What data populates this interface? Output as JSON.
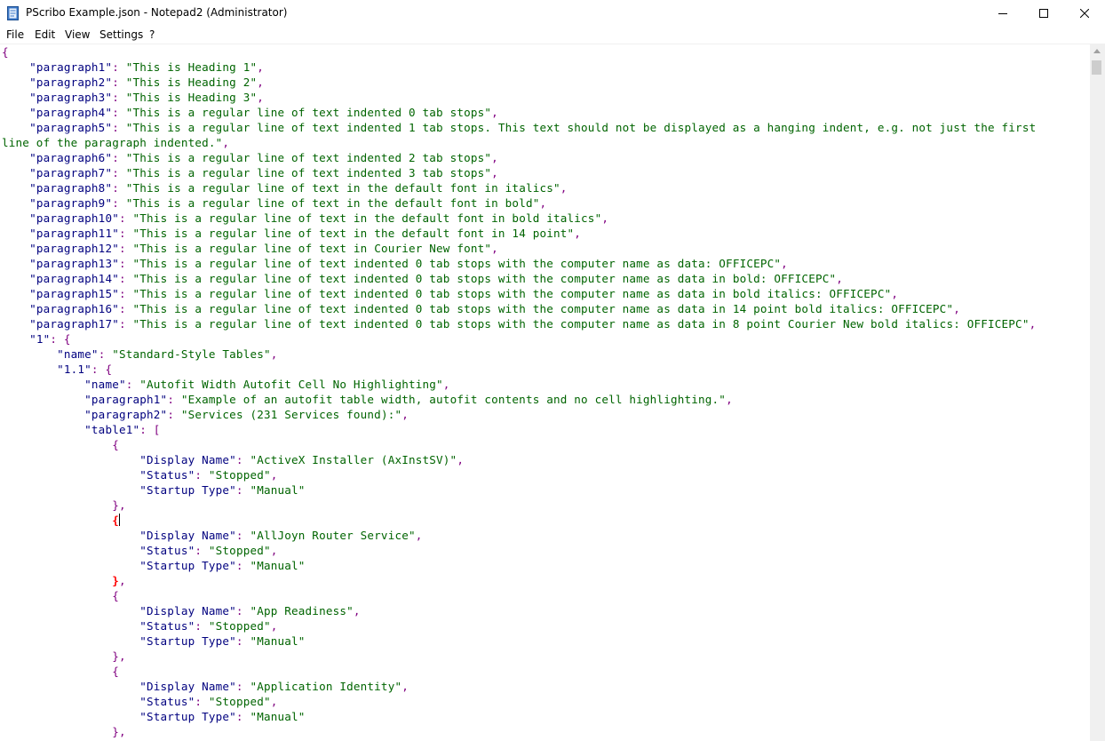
{
  "window": {
    "title": "PScribo Example.json - Notepad2 (Administrator)",
    "minimize_icon": "minimize-icon",
    "maximize_icon": "maximize-icon",
    "close_icon": "close-icon"
  },
  "menu": {
    "items": [
      {
        "label": "File"
      },
      {
        "label": "Edit"
      },
      {
        "label": "View"
      },
      {
        "label": "Settings"
      },
      {
        "label": "?"
      }
    ]
  },
  "colors": {
    "key": "#00007f",
    "string": "#006400",
    "punct": "#800080",
    "brace_highlight": "#ff0000"
  },
  "editor": {
    "lines": [
      [
        [
          "p",
          "{"
        ]
      ],
      [
        [
          "p",
          "    "
        ],
        [
          "k",
          "\"paragraph1\""
        ],
        [
          "p",
          ": "
        ],
        [
          "s",
          "\"This is Heading 1\""
        ],
        [
          "p",
          ","
        ]
      ],
      [
        [
          "p",
          "    "
        ],
        [
          "k",
          "\"paragraph2\""
        ],
        [
          "p",
          ": "
        ],
        [
          "s",
          "\"This is Heading 2\""
        ],
        [
          "p",
          ","
        ]
      ],
      [
        [
          "p",
          "    "
        ],
        [
          "k",
          "\"paragraph3\""
        ],
        [
          "p",
          ": "
        ],
        [
          "s",
          "\"This is Heading 3\""
        ],
        [
          "p",
          ","
        ]
      ],
      [
        [
          "p",
          "    "
        ],
        [
          "k",
          "\"paragraph4\""
        ],
        [
          "p",
          ": "
        ],
        [
          "s",
          "\"This is a regular line of text indented 0 tab stops\""
        ],
        [
          "p",
          ","
        ]
      ],
      [
        [
          "p",
          "    "
        ],
        [
          "k",
          "\"paragraph5\""
        ],
        [
          "p",
          ": "
        ],
        [
          "s",
          "\"This is a regular line of text indented 1 tab stops. This text should not be displayed as a hanging indent, e.g. not just the first"
        ]
      ],
      [
        [
          "s",
          "line of the paragraph indented.\""
        ],
        [
          "p",
          ","
        ]
      ],
      [
        [
          "p",
          "    "
        ],
        [
          "k",
          "\"paragraph6\""
        ],
        [
          "p",
          ": "
        ],
        [
          "s",
          "\"This is a regular line of text indented 2 tab stops\""
        ],
        [
          "p",
          ","
        ]
      ],
      [
        [
          "p",
          "    "
        ],
        [
          "k",
          "\"paragraph7\""
        ],
        [
          "p",
          ": "
        ],
        [
          "s",
          "\"This is a regular line of text indented 3 tab stops\""
        ],
        [
          "p",
          ","
        ]
      ],
      [
        [
          "p",
          "    "
        ],
        [
          "k",
          "\"paragraph8\""
        ],
        [
          "p",
          ": "
        ],
        [
          "s",
          "\"This is a regular line of text in the default font in italics\""
        ],
        [
          "p",
          ","
        ]
      ],
      [
        [
          "p",
          "    "
        ],
        [
          "k",
          "\"paragraph9\""
        ],
        [
          "p",
          ": "
        ],
        [
          "s",
          "\"This is a regular line of text in the default font in bold\""
        ],
        [
          "p",
          ","
        ]
      ],
      [
        [
          "p",
          "    "
        ],
        [
          "k",
          "\"paragraph10\""
        ],
        [
          "p",
          ": "
        ],
        [
          "s",
          "\"This is a regular line of text in the default font in bold italics\""
        ],
        [
          "p",
          ","
        ]
      ],
      [
        [
          "p",
          "    "
        ],
        [
          "k",
          "\"paragraph11\""
        ],
        [
          "p",
          ": "
        ],
        [
          "s",
          "\"This is a regular line of text in the default font in 14 point\""
        ],
        [
          "p",
          ","
        ]
      ],
      [
        [
          "p",
          "    "
        ],
        [
          "k",
          "\"paragraph12\""
        ],
        [
          "p",
          ": "
        ],
        [
          "s",
          "\"This is a regular line of text in Courier New font\""
        ],
        [
          "p",
          ","
        ]
      ],
      [
        [
          "p",
          "    "
        ],
        [
          "k",
          "\"paragraph13\""
        ],
        [
          "p",
          ": "
        ],
        [
          "s",
          "\"This is a regular line of text indented 0 tab stops with the computer name as data: OFFICEPC\""
        ],
        [
          "p",
          ","
        ]
      ],
      [
        [
          "p",
          "    "
        ],
        [
          "k",
          "\"paragraph14\""
        ],
        [
          "p",
          ": "
        ],
        [
          "s",
          "\"This is a regular line of text indented 0 tab stops with the computer name as data in bold: OFFICEPC\""
        ],
        [
          "p",
          ","
        ]
      ],
      [
        [
          "p",
          "    "
        ],
        [
          "k",
          "\"paragraph15\""
        ],
        [
          "p",
          ": "
        ],
        [
          "s",
          "\"This is a regular line of text indented 0 tab stops with the computer name as data in bold italics: OFFICEPC\""
        ],
        [
          "p",
          ","
        ]
      ],
      [
        [
          "p",
          "    "
        ],
        [
          "k",
          "\"paragraph16\""
        ],
        [
          "p",
          ": "
        ],
        [
          "s",
          "\"This is a regular line of text indented 0 tab stops with the computer name as data in 14 point bold italics: OFFICEPC\""
        ],
        [
          "p",
          ","
        ]
      ],
      [
        [
          "p",
          "    "
        ],
        [
          "k",
          "\"paragraph17\""
        ],
        [
          "p",
          ": "
        ],
        [
          "s",
          "\"This is a regular line of text indented 0 tab stops with the computer name as data in 8 point Courier New bold italics: OFFICEPC\""
        ],
        [
          "p",
          ","
        ]
      ],
      [
        [
          "p",
          "    "
        ],
        [
          "k",
          "\"1\""
        ],
        [
          "p",
          ": {"
        ]
      ],
      [
        [
          "p",
          "        "
        ],
        [
          "k",
          "\"name\""
        ],
        [
          "p",
          ": "
        ],
        [
          "s",
          "\"Standard-Style Tables\""
        ],
        [
          "p",
          ","
        ]
      ],
      [
        [
          "p",
          "        "
        ],
        [
          "k",
          "\"1.1\""
        ],
        [
          "p",
          ": {"
        ]
      ],
      [
        [
          "p",
          "            "
        ],
        [
          "k",
          "\"name\""
        ],
        [
          "p",
          ": "
        ],
        [
          "s",
          "\"Autofit Width Autofit Cell No Highlighting\""
        ],
        [
          "p",
          ","
        ]
      ],
      [
        [
          "p",
          "            "
        ],
        [
          "k",
          "\"paragraph1\""
        ],
        [
          "p",
          ": "
        ],
        [
          "s",
          "\"Example of an autofit table width, autofit contents and no cell highlighting.\""
        ],
        [
          "p",
          ","
        ]
      ],
      [
        [
          "p",
          "            "
        ],
        [
          "k",
          "\"paragraph2\""
        ],
        [
          "p",
          ": "
        ],
        [
          "s",
          "\"Services (231 Services found):\""
        ],
        [
          "p",
          ","
        ]
      ],
      [
        [
          "p",
          "            "
        ],
        [
          "k",
          "\"table1\""
        ],
        [
          "p",
          ": ["
        ]
      ],
      [
        [
          "p",
          "                {"
        ]
      ],
      [
        [
          "p",
          "                    "
        ],
        [
          "k",
          "\"Display Name\""
        ],
        [
          "p",
          ": "
        ],
        [
          "s",
          "\"ActiveX Installer (AxInstSV)\""
        ],
        [
          "p",
          ","
        ]
      ],
      [
        [
          "p",
          "                    "
        ],
        [
          "k",
          "\"Status\""
        ],
        [
          "p",
          ": "
        ],
        [
          "s",
          "\"Stopped\""
        ],
        [
          "p",
          ","
        ]
      ],
      [
        [
          "p",
          "                    "
        ],
        [
          "k",
          "\"Startup Type\""
        ],
        [
          "p",
          ": "
        ],
        [
          "s",
          "\"Manual\""
        ]
      ],
      [
        [
          "p",
          "                },"
        ]
      ],
      [
        [
          "p",
          "                "
        ],
        [
          "b",
          "{"
        ]
      ],
      [
        [
          "p",
          "                    "
        ],
        [
          "k",
          "\"Display Name\""
        ],
        [
          "p",
          ": "
        ],
        [
          "s",
          "\"AllJoyn Router Service\""
        ],
        [
          "p",
          ","
        ]
      ],
      [
        [
          "p",
          "                    "
        ],
        [
          "k",
          "\"Status\""
        ],
        [
          "p",
          ": "
        ],
        [
          "s",
          "\"Stopped\""
        ],
        [
          "p",
          ","
        ]
      ],
      [
        [
          "p",
          "                    "
        ],
        [
          "k",
          "\"Startup Type\""
        ],
        [
          "p",
          ": "
        ],
        [
          "s",
          "\"Manual\""
        ]
      ],
      [
        [
          "p",
          "                "
        ],
        [
          "b",
          "}"
        ],
        [
          "p",
          ","
        ]
      ],
      [
        [
          "p",
          "                {"
        ]
      ],
      [
        [
          "p",
          "                    "
        ],
        [
          "k",
          "\"Display Name\""
        ],
        [
          "p",
          ": "
        ],
        [
          "s",
          "\"App Readiness\""
        ],
        [
          "p",
          ","
        ]
      ],
      [
        [
          "p",
          "                    "
        ],
        [
          "k",
          "\"Status\""
        ],
        [
          "p",
          ": "
        ],
        [
          "s",
          "\"Stopped\""
        ],
        [
          "p",
          ","
        ]
      ],
      [
        [
          "p",
          "                    "
        ],
        [
          "k",
          "\"Startup Type\""
        ],
        [
          "p",
          ": "
        ],
        [
          "s",
          "\"Manual\""
        ]
      ],
      [
        [
          "p",
          "                },"
        ]
      ],
      [
        [
          "p",
          "                {"
        ]
      ],
      [
        [
          "p",
          "                    "
        ],
        [
          "k",
          "\"Display Name\""
        ],
        [
          "p",
          ": "
        ],
        [
          "s",
          "\"Application Identity\""
        ],
        [
          "p",
          ","
        ]
      ],
      [
        [
          "p",
          "                    "
        ],
        [
          "k",
          "\"Status\""
        ],
        [
          "p",
          ": "
        ],
        [
          "s",
          "\"Stopped\""
        ],
        [
          "p",
          ","
        ]
      ],
      [
        [
          "p",
          "                    "
        ],
        [
          "k",
          "\"Startup Type\""
        ],
        [
          "p",
          ": "
        ],
        [
          "s",
          "\"Manual\""
        ]
      ],
      [
        [
          "p",
          "                },"
        ]
      ]
    ]
  }
}
